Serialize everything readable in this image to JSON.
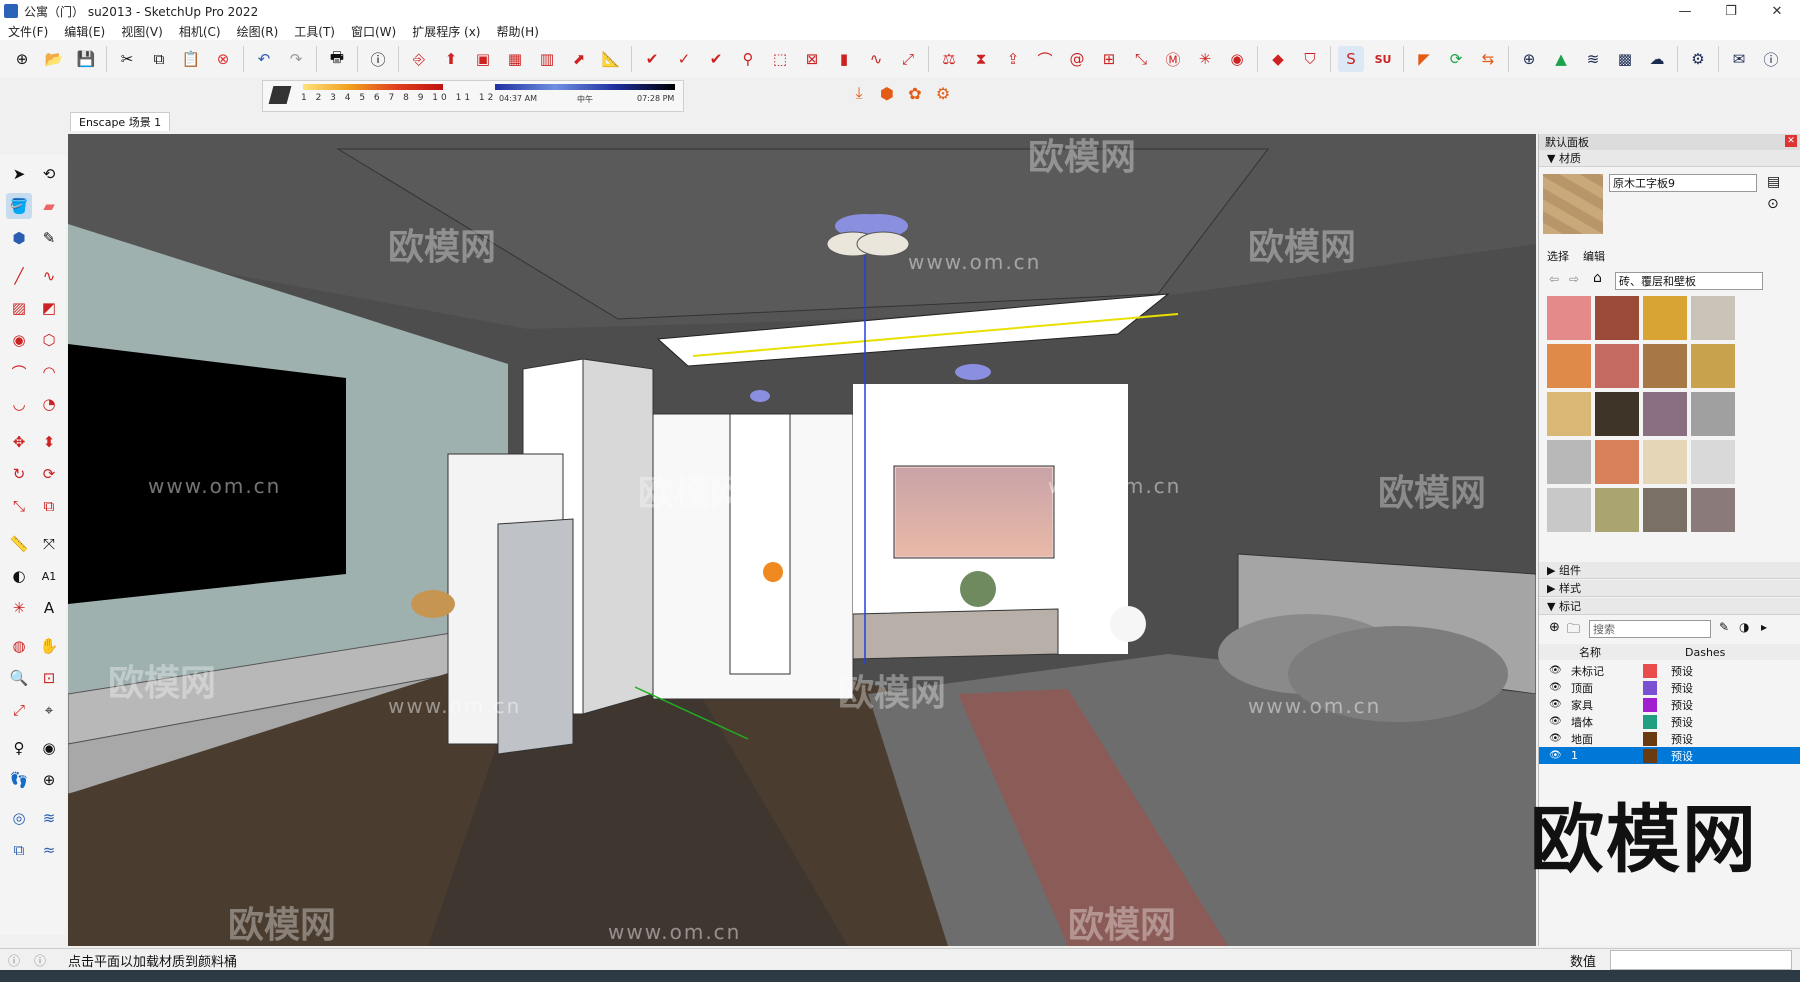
{
  "window": {
    "title": "公寓（门） su2013 - SketchUp Pro 2022",
    "controls": [
      "—",
      "❐",
      "✕"
    ]
  },
  "menu": [
    "文件(F)",
    "编辑(E)",
    "视图(V)",
    "相机(C)",
    "绘图(R)",
    "工具(T)",
    "窗口(W)",
    "扩展程序 (x)",
    "帮助(H)"
  ],
  "shadow": {
    "months": "1 2 3 4 5 6 7 8 9 10 11 12",
    "time_start": "04:37 AM",
    "time_mid": "中午",
    "time_end": "07:28 PM"
  },
  "scene_tab": "Enscape 场景 1",
  "panel": {
    "title": "默认面板",
    "materials_section": "材质",
    "material_name": "原木工字板9",
    "tab_select": "选择",
    "tab_edit": "编辑",
    "library": "砖、覆层和壁板",
    "components": "组件",
    "styles": "样式",
    "tags": "标记",
    "tag_search_placeholder": "搜索",
    "col_name": "名称",
    "col_dashes": "Dashes",
    "tag_rows": [
      {
        "name": "未标记",
        "color": "#e84c4c",
        "dash": "预设"
      },
      {
        "name": "顶面",
        "color": "#7a4fd0",
        "dash": "预设"
      },
      {
        "name": "家具",
        "color": "#a020d0",
        "dash": "预设"
      },
      {
        "name": "墙体",
        "color": "#20a080",
        "dash": "预设"
      },
      {
        "name": "地面",
        "color": "#6a3a10",
        "dash": "预设"
      },
      {
        "name": "1",
        "color": "#6a3a10",
        "dash": "预设"
      }
    ]
  },
  "watermark": {
    "logo": "欧模网",
    "url": "www.om.cn"
  },
  "status": {
    "message": "点击平面以加载材质到颜料桶",
    "value_label": "数值"
  }
}
